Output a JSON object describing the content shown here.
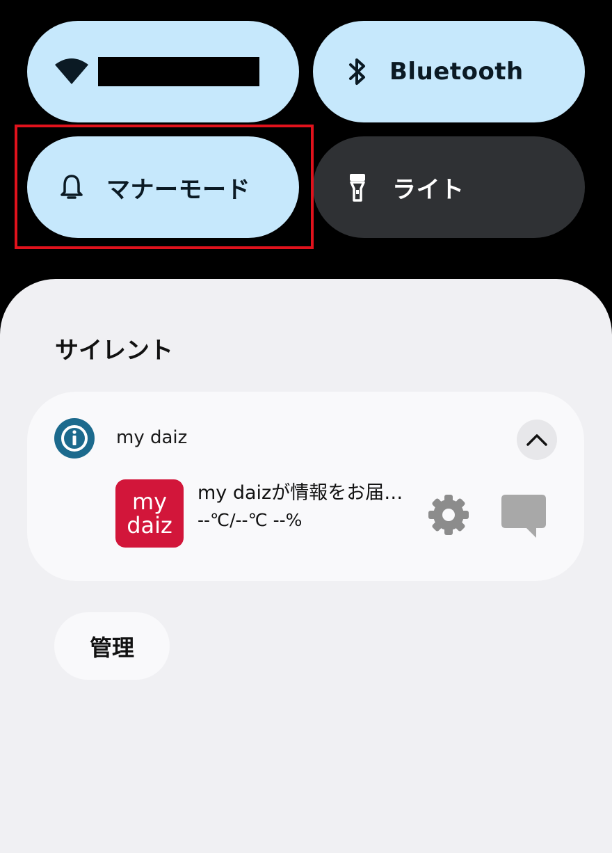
{
  "quick_settings": {
    "wifi": {
      "label": "",
      "state": "on"
    },
    "bluetooth": {
      "label": "Bluetooth",
      "state": "on"
    },
    "manner_mode": {
      "label": "マナーモード",
      "state": "on"
    },
    "flashlight": {
      "label": "ライト",
      "state": "off"
    }
  },
  "notifications": {
    "section_title": "サイレント",
    "card": {
      "app_name": "my daiz",
      "thumbnail_line1": "my",
      "thumbnail_line2": "daiz",
      "title": "my daizが情報をお届…",
      "body": "--℃/--℃ --%"
    },
    "manage_label": "管理"
  },
  "colors": {
    "tile_on": "#c6e8fc",
    "tile_off": "#2f3134",
    "highlight": "#e0121c",
    "app_icon": "#1c6a8d",
    "thumbnail": "#d2163a"
  }
}
